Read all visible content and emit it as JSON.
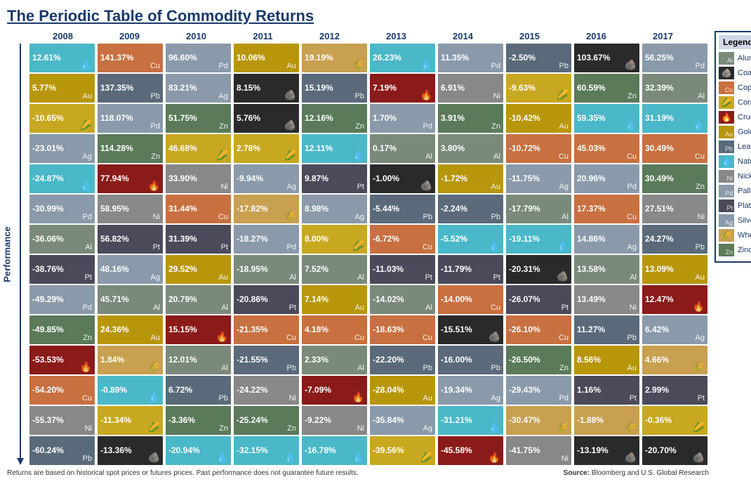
{
  "title": "The Periodic Table of Commodity Returns",
  "years": [
    "2008",
    "2009",
    "2010",
    "2011",
    "2012",
    "2013",
    "2014",
    "2015",
    "2016",
    "2017"
  ],
  "performance_label": "Performance",
  "footer_left": "Returns are based on historical spot prices or futures prices. Past performance does not guarantee future results.",
  "footer_right": "Source: Bloomberg and U.S. Global Research",
  "legend": {
    "title": "Legend",
    "items": [
      {
        "label": "Aluminum",
        "color": "aluminum",
        "symbol": "Al"
      },
      {
        "label": "Coal",
        "color": "coal",
        "symbol": "●"
      },
      {
        "label": "Copper",
        "color": "copper",
        "symbol": "Cu"
      },
      {
        "label": "Corn",
        "color": "corn",
        "symbol": "🌽"
      },
      {
        "label": "Crude Oil",
        "color": "crude-oil",
        "symbol": "🔥"
      },
      {
        "label": "Gold",
        "color": "gold",
        "symbol": "Au"
      },
      {
        "label": "Lead",
        "color": "lead",
        "symbol": "Pb"
      },
      {
        "label": "Natural Gas",
        "color": "natural-gas",
        "symbol": "~"
      },
      {
        "label": "Nickel",
        "color": "nickel",
        "symbol": "Ni"
      },
      {
        "label": "Palladium",
        "color": "palladium",
        "symbol": "Pd"
      },
      {
        "label": "Platinum",
        "color": "platinum",
        "symbol": "Pt"
      },
      {
        "label": "Silver",
        "color": "silver",
        "symbol": "Ag"
      },
      {
        "label": "Wheat",
        "color": "wheat",
        "symbol": "🌾"
      },
      {
        "label": "Zinc",
        "color": "zinc",
        "symbol": "Zn"
      }
    ]
  },
  "columns": [
    {
      "year": "2008",
      "cells": [
        {
          "value": "12.61%",
          "commodity": "natural-gas",
          "symbol": ""
        },
        {
          "value": "5.77%",
          "commodity": "gold",
          "symbol": "Au"
        },
        {
          "value": "-10.65%",
          "commodity": "corn",
          "symbol": ""
        },
        {
          "value": "-23.01%",
          "commodity": "silver",
          "symbol": "Ag"
        },
        {
          "value": "-24.87%",
          "commodity": "natural-gas",
          "symbol": ""
        },
        {
          "value": "-30.99%",
          "commodity": "palladium",
          "symbol": ""
        },
        {
          "value": "-36.06%",
          "commodity": "aluminum",
          "symbol": "Al"
        },
        {
          "value": "-38.76%",
          "commodity": "platinum",
          "symbol": "Pt"
        },
        {
          "value": "-49.29%",
          "commodity": "palladium",
          "symbol": "Pd"
        },
        {
          "value": "-49.85%",
          "commodity": "zinc",
          "symbol": "Zn"
        },
        {
          "value": "-53.53%",
          "commodity": "crude-oil",
          "symbol": ""
        },
        {
          "value": "-54.20%",
          "commodity": "copper",
          "symbol": "Cu"
        },
        {
          "value": "-55.37%",
          "commodity": "nickel",
          "symbol": "Ni"
        },
        {
          "value": "-60.24%",
          "commodity": "lead",
          "symbol": "Pb"
        }
      ]
    },
    {
      "year": "2009",
      "cells": [
        {
          "value": "141.37%",
          "commodity": "copper",
          "symbol": "Cu"
        },
        {
          "value": "137.35%",
          "commodity": "lead",
          "symbol": "Pb"
        },
        {
          "value": "118.07%",
          "commodity": "palladium",
          "symbol": "Pd"
        },
        {
          "value": "114.28%",
          "commodity": "zinc",
          "symbol": "Zn"
        },
        {
          "value": "77.94%",
          "commodity": "crude-oil",
          "symbol": ""
        },
        {
          "value": "58.95%",
          "commodity": "nickel",
          "symbol": "Ni"
        },
        {
          "value": "56.82%",
          "commodity": "platinum",
          "symbol": "Pt"
        },
        {
          "value": "48.16%",
          "commodity": "silver",
          "symbol": "Ag"
        },
        {
          "value": "45.71%",
          "commodity": "aluminum",
          "symbol": "Al"
        },
        {
          "value": "24.36%",
          "commodity": "gold",
          "symbol": "Au"
        },
        {
          "value": "1.84%",
          "commodity": "wheat",
          "symbol": ""
        },
        {
          "value": "-0.89%",
          "commodity": "natural-gas",
          "symbol": ""
        },
        {
          "value": "-11.34%",
          "commodity": "corn",
          "symbol": ""
        },
        {
          "value": "-13.36%",
          "commodity": "coal",
          "symbol": ""
        }
      ]
    },
    {
      "year": "2010",
      "cells": [
        {
          "value": "96.60%",
          "commodity": "palladium",
          "symbol": "Pd"
        },
        {
          "value": "83.21%",
          "commodity": "silver",
          "symbol": "Ag"
        },
        {
          "value": "51.75%",
          "commodity": "zinc",
          "symbol": "Zn"
        },
        {
          "value": "46.68%",
          "commodity": "corn",
          "symbol": ""
        },
        {
          "value": "33.90%",
          "commodity": "nickel",
          "symbol": "Ni"
        },
        {
          "value": "31.44%",
          "commodity": "copper",
          "symbol": "Cu"
        },
        {
          "value": "31.39%",
          "commodity": "platinum",
          "symbol": "Pt"
        },
        {
          "value": "29.52%",
          "commodity": "gold",
          "symbol": "Au"
        },
        {
          "value": "20.79%",
          "commodity": "aluminum",
          "symbol": ""
        },
        {
          "value": "15.15%",
          "commodity": "crude-oil",
          "symbol": ""
        },
        {
          "value": "12.01%",
          "commodity": "aluminum",
          "symbol": "Al"
        },
        {
          "value": "6.72%",
          "commodity": "lead",
          "symbol": "Pb"
        },
        {
          "value": "-3.36%",
          "commodity": "zinc",
          "symbol": "Zn"
        },
        {
          "value": "-20.94%",
          "commodity": "natural-gas",
          "symbol": ""
        }
      ]
    },
    {
      "year": "2011",
      "cells": [
        {
          "value": "10.06%",
          "commodity": "gold",
          "symbol": "Au"
        },
        {
          "value": "8.15%",
          "commodity": "coal",
          "symbol": ""
        },
        {
          "value": "5.76%",
          "commodity": "coal",
          "symbol": ""
        },
        {
          "value": "2.78%",
          "commodity": "corn",
          "symbol": ""
        },
        {
          "value": "-9.94%",
          "commodity": "silver",
          "symbol": "Ag"
        },
        {
          "value": "-17.82%",
          "commodity": "wheat",
          "symbol": ""
        },
        {
          "value": "-18.27%",
          "commodity": "palladium",
          "symbol": "Pd"
        },
        {
          "value": "-18.95%",
          "commodity": "aluminum",
          "symbol": "Al"
        },
        {
          "value": "-20.86%",
          "commodity": "platinum",
          "symbol": "Pt"
        },
        {
          "value": "-21.35%",
          "commodity": "copper",
          "symbol": "Cu"
        },
        {
          "value": "-21.55%",
          "commodity": "lead",
          "symbol": "Pb"
        },
        {
          "value": "-24.22%",
          "commodity": "nickel",
          "symbol": "Ni"
        },
        {
          "value": "-25.24%",
          "commodity": "zinc",
          "symbol": "Zn"
        },
        {
          "value": "-32.15%",
          "commodity": "natural-gas",
          "symbol": ""
        }
      ]
    },
    {
      "year": "2012",
      "cells": [
        {
          "value": "19.19%",
          "commodity": "wheat",
          "symbol": ""
        },
        {
          "value": "15.19%",
          "commodity": "lead",
          "symbol": "Pb"
        },
        {
          "value": "12.16%",
          "commodity": "zinc",
          "symbol": "Zn"
        },
        {
          "value": "12.11%",
          "commodity": "natural-gas",
          "symbol": ""
        },
        {
          "value": "9.87%",
          "commodity": "platinum",
          "symbol": "Pt"
        },
        {
          "value": "8.98%",
          "commodity": "silver",
          "symbol": "Ag"
        },
        {
          "value": "8.00%",
          "commodity": "corn",
          "symbol": ""
        },
        {
          "value": "7.52%",
          "commodity": "aluminum",
          "symbol": "Al"
        },
        {
          "value": "7.14%",
          "commodity": "gold",
          "symbol": "Au"
        },
        {
          "value": "4.18%",
          "commodity": "copper",
          "symbol": "Cu"
        },
        {
          "value": "2.33%",
          "commodity": "aluminum",
          "symbol": "Al"
        },
        {
          "value": "-7.09%",
          "commodity": "crude-oil",
          "symbol": ""
        },
        {
          "value": "-9.22%",
          "commodity": "nickel",
          "symbol": "Ni"
        },
        {
          "value": "-16.78%",
          "commodity": "natural-gas",
          "symbol": ""
        }
      ]
    },
    {
      "year": "2013",
      "cells": [
        {
          "value": "26.23%",
          "commodity": "natural-gas",
          "symbol": ""
        },
        {
          "value": "7.19%",
          "commodity": "crude-oil",
          "symbol": ""
        },
        {
          "value": "1.70%",
          "commodity": "palladium",
          "symbol": "Pd"
        },
        {
          "value": "0.17%",
          "commodity": "aluminum",
          "symbol": "Al"
        },
        {
          "value": "-1.00%",
          "commodity": "coal",
          "symbol": ""
        },
        {
          "value": "-5.44%",
          "commodity": "lead",
          "symbol": "Pb"
        },
        {
          "value": "-6.72%",
          "commodity": "copper",
          "symbol": "Cu"
        },
        {
          "value": "-11.03%",
          "commodity": "platinum",
          "symbol": "Pt"
        },
        {
          "value": "-14.02%",
          "commodity": "aluminum",
          "symbol": "Al"
        },
        {
          "value": "-18.63%",
          "commodity": "copper",
          "symbol": "Cu"
        },
        {
          "value": "-22.20%",
          "commodity": "lead",
          "symbol": "Pb"
        },
        {
          "value": "-28.04%",
          "commodity": "gold",
          "symbol": "Au"
        },
        {
          "value": "-35.84%",
          "commodity": "silver",
          "symbol": "Ag"
        },
        {
          "value": "-39.56%",
          "commodity": "corn",
          "symbol": ""
        }
      ]
    },
    {
      "year": "2014",
      "cells": [
        {
          "value": "11.35%",
          "commodity": "palladium",
          "symbol": "Pd"
        },
        {
          "value": "6.91%",
          "commodity": "nickel",
          "symbol": "Ni"
        },
        {
          "value": "3.91%",
          "commodity": "zinc",
          "symbol": "Zn"
        },
        {
          "value": "3.80%",
          "commodity": "aluminum",
          "symbol": "Al"
        },
        {
          "value": "-1.72%",
          "commodity": "gold",
          "symbol": "Au"
        },
        {
          "value": "-2.24%",
          "commodity": "lead",
          "symbol": "Pb"
        },
        {
          "value": "-5.52%",
          "commodity": "natural-gas",
          "symbol": ""
        },
        {
          "value": "-11.79%",
          "commodity": "platinum",
          "symbol": "Pt"
        },
        {
          "value": "-14.00%",
          "commodity": "copper",
          "symbol": "Cu"
        },
        {
          "value": "-15.51%",
          "commodity": "coal",
          "symbol": ""
        },
        {
          "value": "-16.00%",
          "commodity": "lead",
          "symbol": "Pb"
        },
        {
          "value": "-19.34%",
          "commodity": "silver",
          "symbol": "Ag"
        },
        {
          "value": "-31.21%",
          "commodity": "natural-gas",
          "symbol": ""
        },
        {
          "value": "-45.58%",
          "commodity": "crude-oil",
          "symbol": ""
        }
      ]
    },
    {
      "year": "2015",
      "cells": [
        {
          "value": "-2.50%",
          "commodity": "lead",
          "symbol": "Pb"
        },
        {
          "value": "-9.63%",
          "commodity": "corn",
          "symbol": ""
        },
        {
          "value": "-10.42%",
          "commodity": "gold",
          "symbol": "Au"
        },
        {
          "value": "-10.72%",
          "commodity": "copper",
          "symbol": "Cu"
        },
        {
          "value": "-11.75%",
          "commodity": "silver",
          "symbol": "Ag"
        },
        {
          "value": "-17.79%",
          "commodity": "aluminum",
          "symbol": "Al"
        },
        {
          "value": "-19.11%",
          "commodity": "natural-gas",
          "symbol": ""
        },
        {
          "value": "-20.31%",
          "commodity": "coal",
          "symbol": ""
        },
        {
          "value": "-26.07%",
          "commodity": "platinum",
          "symbol": "Pt"
        },
        {
          "value": "-26.10%",
          "commodity": "copper",
          "symbol": "Cu"
        },
        {
          "value": "-26.50%",
          "commodity": "zinc",
          "symbol": "Zn"
        },
        {
          "value": "-29.43%",
          "commodity": "palladium",
          "symbol": "Pd"
        },
        {
          "value": "-30.47%",
          "commodity": "wheat",
          "symbol": ""
        },
        {
          "value": "-41.75%",
          "commodity": "nickel",
          "symbol": "Ni"
        }
      ]
    },
    {
      "year": "2016",
      "cells": [
        {
          "value": "103.67%",
          "commodity": "coal",
          "symbol": ""
        },
        {
          "value": "60.59%",
          "commodity": "zinc",
          "symbol": "Zn"
        },
        {
          "value": "59.35%",
          "commodity": "natural-gas",
          "symbol": ""
        },
        {
          "value": "45.03%",
          "commodity": "copper",
          "symbol": "Cu"
        },
        {
          "value": "20.96%",
          "commodity": "palladium",
          "symbol": "Pd"
        },
        {
          "value": "17.37%",
          "commodity": "copper",
          "symbol": "Cu"
        },
        {
          "value": "14.86%",
          "commodity": "silver",
          "symbol": "Ag"
        },
        {
          "value": "13.58%",
          "commodity": "aluminum",
          "symbol": "Al"
        },
        {
          "value": "13.49%",
          "commodity": "nickel",
          "symbol": "Ni"
        },
        {
          "value": "11.27%",
          "commodity": "lead",
          "symbol": "Pb"
        },
        {
          "value": "8.56%",
          "commodity": "gold",
          "symbol": "Au"
        },
        {
          "value": "1.16%",
          "commodity": "platinum",
          "symbol": "Pt"
        },
        {
          "value": "-1.88%",
          "commodity": "wheat",
          "symbol": ""
        },
        {
          "value": "-13.19%",
          "commodity": "coal",
          "symbol": ""
        }
      ]
    },
    {
      "year": "2017",
      "cells": [
        {
          "value": "56.25%",
          "commodity": "palladium",
          "symbol": "Pd"
        },
        {
          "value": "32.39%",
          "commodity": "aluminum",
          "symbol": "Al"
        },
        {
          "value": "31.19%",
          "commodity": "natural-gas",
          "symbol": ""
        },
        {
          "value": "30.49%",
          "commodity": "copper",
          "symbol": "Cu"
        },
        {
          "value": "30.49%",
          "commodity": "zinc",
          "symbol": "Zn"
        },
        {
          "value": "27.51%",
          "commodity": "nickel",
          "symbol": "Ni"
        },
        {
          "value": "24.27%",
          "commodity": "lead",
          "symbol": "Pb"
        },
        {
          "value": "13.09%",
          "commodity": "gold",
          "symbol": "Au"
        },
        {
          "value": "12.47%",
          "commodity": "crude-oil",
          "symbol": ""
        },
        {
          "value": "6.42%",
          "commodity": "silver",
          "symbol": "Ag"
        },
        {
          "value": "4.66%",
          "commodity": "wheat",
          "symbol": ""
        },
        {
          "value": "2.99%",
          "commodity": "platinum",
          "symbol": "Pt"
        },
        {
          "value": "-0.36%",
          "commodity": "corn",
          "symbol": ""
        },
        {
          "value": "-20.70%",
          "commodity": "coal",
          "symbol": ""
        }
      ]
    }
  ]
}
